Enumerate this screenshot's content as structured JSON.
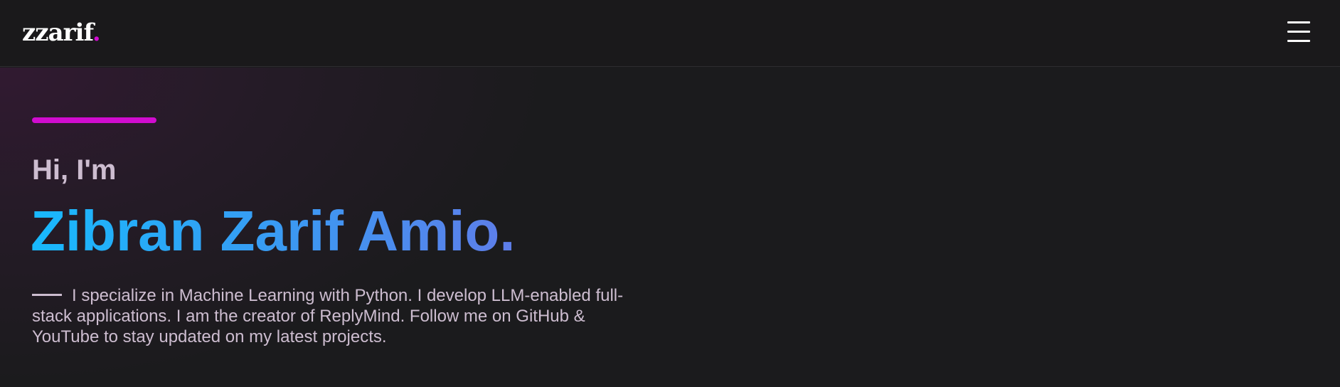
{
  "header": {
    "logo_text": "zzarif",
    "logo_dot": ".",
    "menu_icon": "hamburger-menu-icon"
  },
  "hero": {
    "greeting": "Hi, I'm",
    "name": "Zibran Zarif Amio.",
    "intro": "I specialize in Machine Learning with Python. I develop LLM-enabled full-stack applications. I am the creator of ReplyMind. Follow me on GitHub & YouTube to stay updated on my latest projects."
  },
  "colors": {
    "accent": "#d10ccf",
    "background": "#1b1b1d",
    "name_gradient_start": "#18b9fd",
    "name_gradient_end": "#5f7de9",
    "muted_text": "#cdbdd0"
  }
}
